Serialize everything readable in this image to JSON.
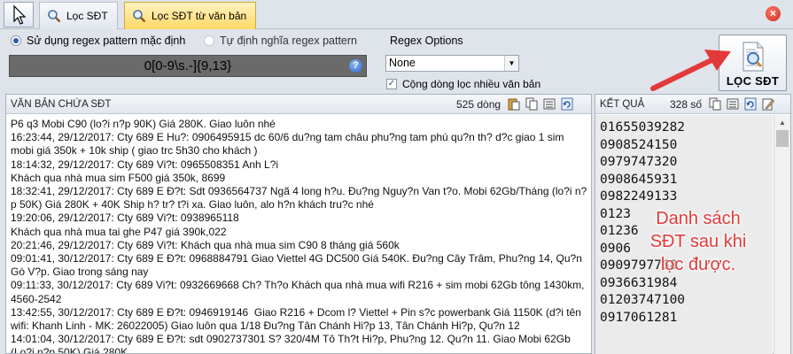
{
  "tabs": [
    {
      "label": "Lọc SĐT",
      "active": false
    },
    {
      "label": "Lọc SĐT từ văn bản",
      "active": true
    }
  ],
  "options": {
    "radio_default": "Sử dụng regex pattern mặc định",
    "radio_custom": "Tự định nghĩa regex pattern",
    "pattern": "0[0-9\\s.-]{9,13}",
    "regex_options_label": "Regex Options",
    "regex_option_selected": "None",
    "multiline_checkbox": "Cộng dòng lọc nhiều văn bản",
    "multiline_checked": true
  },
  "filter_button": {
    "label": "LỌC SĐT"
  },
  "source_panel": {
    "title": "VĂN BẢN CHỨA SĐT",
    "count": "525 dòng",
    "text": "P6 q3 Mobi C90 (lo?i n?p 90K) Giá 280K. Giao luôn nhé\n16:23:44, 29/12/2017: Cty 689 E Hu?: 0906495915 dc 60/6 du?ng tam châu phu?ng tam phú qu?n th? d?c giao 1 sim mobi giá 350k + 10k ship ( giao trc 5h30 cho khách )\n18:14:32, 29/12/2017: Cty 689 Vi?t: 0965508351 Anh L?i\nKhách qua nhà mua sim F500 giá 350k, 8699\n18:32:41, 29/12/2017: Cty 689 E Đ?t: Sdt 0936564737 Ngã 4 long h?u. Đu?ng Nguy?n Van t?o. Mobi 62Gb/Tháng (lo?i n?p 50K) Giá 280K + 40K Ship h? tr? t?i xa. Giao luôn, alo h?n khách tru?c nhé\n19:20:06, 29/12/2017: Cty 689 Vi?t: 0938965118\nKhách qua nhà mua tai ghe P47 giá 390k,022\n20:21:46, 29/12/2017: Cty 689 Vi?t: Khách qua nhà mua sim C90 8 tháng giá 560k\n09:01:41, 30/12/2017: Cty 689 E Đ?t: 0968884791 Giao Viettel 4G DC500 Giá 540K. Đu?ng Cây Trâm, Phu?ng 14, Qu?n Gò V?p. Giao trong sáng nay\n09:11:33, 30/12/2017: Cty 689 Vi?t: 0932669668 Ch? Th?o Khách qua nhà mua wifi R216 + sim mobi 62Gb tông 1430km, 4560-2542\n13:42:55, 30/12/2017: Cty 689 E Đ?t: 0946919146  Giao R216 + Dcom l? Viettel + Pin s?c powerbank Giá 1150K (d?i tên wifi: Khanh Linh - MK: 26022005) Giao luôn qua 1/18 Đu?ng Tân Chánh Hi?p 13, Tân Chánh Hi?p, Qu?n 12\n14:01:04, 30/12/2017: Cty 689 E Đ?t: sdt 0902737301 S? 320/4M Tô Th?t Hi?p, Phu?ng 12. Qu?n 11. Giao Mobi 62Gb (Lo?i n?p 50K) Giá 280K"
  },
  "result_panel": {
    "title": "KẾT QUẢ",
    "count": "328 số",
    "numbers": [
      "01655039282",
      "0908524150",
      "0979747320",
      "0908645931",
      "0982249133",
      "0123",
      "01236",
      "0906",
      "0909797768",
      "0936631984",
      "01203747100",
      "0917061281"
    ]
  },
  "annotation": {
    "lines": [
      "Danh sách",
      "SĐT sau khi",
      "lọc được."
    ],
    "color": "#e23a3a"
  },
  "colors": {
    "active_tab": "#ffd865",
    "annotation": "#e23a3a",
    "pattern_bg": "#6a6a6a"
  }
}
